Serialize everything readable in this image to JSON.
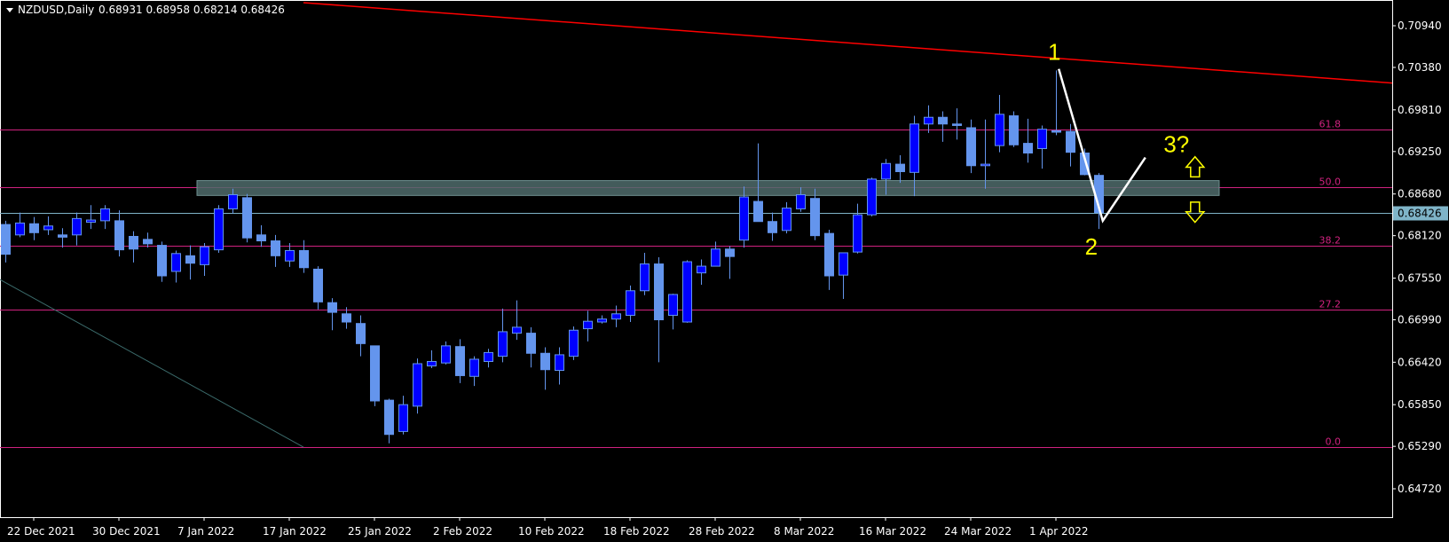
{
  "header": {
    "symbol": "NZDUSD,Daily",
    "ohlc": "0.68931 0.68958 0.68214 0.68426"
  },
  "current_price_label": "0.68426",
  "colors": {
    "background": "#000000",
    "axis": "#ffffff",
    "bull_body": "#0000ff",
    "bear_body": "#6495ed",
    "wick": "#6495ed",
    "fib": "#d0227f",
    "trendline": "#ff0000",
    "zone": "#4f6b6b",
    "annotation": "#ffff00",
    "wave": "#ffffff",
    "price_line": "#7fb4c8",
    "price_tag_bg": "#7fb4c8"
  },
  "chart_data": {
    "type": "candlestick",
    "title": "NZDUSD,Daily",
    "ylim": [
      0.6445,
      0.7125
    ],
    "y_ticks": [
      "0.70940",
      "0.70380",
      "0.69810",
      "0.69250",
      "0.68680",
      "0.68120",
      "0.67550",
      "0.66990",
      "0.66420",
      "0.65850",
      "0.65290",
      "0.64720"
    ],
    "x_tick_labels": [
      {
        "label": "22 Dec 2021",
        "index": 2
      },
      {
        "label": "30 Dec 2021",
        "index": 8
      },
      {
        "label": "7 Jan 2022",
        "index": 14
      },
      {
        "label": "17 Jan 2022",
        "index": 20
      },
      {
        "label": "25 Jan 2022",
        "index": 26
      },
      {
        "label": "2 Feb 2022",
        "index": 32
      },
      {
        "label": "10 Feb 2022",
        "index": 38
      },
      {
        "label": "18 Feb 2022",
        "index": 44
      },
      {
        "label": "28 Feb 2022",
        "index": 50
      },
      {
        "label": "8 Mar 2022",
        "index": 56
      },
      {
        "label": "16 Mar 2022",
        "index": 62
      },
      {
        "label": "24 Mar 2022",
        "index": 68
      },
      {
        "label": "1 Apr 2022",
        "index": 74
      }
    ],
    "candles": [
      {
        "o": 0.6827,
        "h": 0.6832,
        "l": 0.6776,
        "c": 0.6787
      },
      {
        "o": 0.6813,
        "h": 0.6843,
        "l": 0.681,
        "c": 0.6829
      },
      {
        "o": 0.6828,
        "h": 0.6837,
        "l": 0.6806,
        "c": 0.6816
      },
      {
        "o": 0.682,
        "h": 0.6838,
        "l": 0.6813,
        "c": 0.6825
      },
      {
        "o": 0.6813,
        "h": 0.6822,
        "l": 0.6796,
        "c": 0.681
      },
      {
        "o": 0.6813,
        "h": 0.6843,
        "l": 0.6799,
        "c": 0.6835
      },
      {
        "o": 0.683,
        "h": 0.6853,
        "l": 0.6821,
        "c": 0.6833
      },
      {
        "o": 0.6832,
        "h": 0.6853,
        "l": 0.6821,
        "c": 0.6848
      },
      {
        "o": 0.6832,
        "h": 0.6846,
        "l": 0.6784,
        "c": 0.6793
      },
      {
        "o": 0.6811,
        "h": 0.6818,
        "l": 0.6776,
        "c": 0.6794
      },
      {
        "o": 0.6807,
        "h": 0.6816,
        "l": 0.6796,
        "c": 0.6801
      },
      {
        "o": 0.6799,
        "h": 0.6804,
        "l": 0.675,
        "c": 0.6758
      },
      {
        "o": 0.6764,
        "h": 0.6792,
        "l": 0.6749,
        "c": 0.6788
      },
      {
        "o": 0.6785,
        "h": 0.6799,
        "l": 0.6753,
        "c": 0.6775
      },
      {
        "o": 0.6773,
        "h": 0.6802,
        "l": 0.6758,
        "c": 0.6797
      },
      {
        "o": 0.6793,
        "h": 0.6853,
        "l": 0.6789,
        "c": 0.6848
      },
      {
        "o": 0.6848,
        "h": 0.6875,
        "l": 0.6842,
        "c": 0.6867
      },
      {
        "o": 0.6863,
        "h": 0.6868,
        "l": 0.6803,
        "c": 0.6809
      },
      {
        "o": 0.6813,
        "h": 0.6826,
        "l": 0.6797,
        "c": 0.6805
      },
      {
        "o": 0.6805,
        "h": 0.6813,
        "l": 0.677,
        "c": 0.6785
      },
      {
        "o": 0.6778,
        "h": 0.6802,
        "l": 0.677,
        "c": 0.6792
      },
      {
        "o": 0.6792,
        "h": 0.6806,
        "l": 0.6762,
        "c": 0.6769
      },
      {
        "o": 0.6767,
        "h": 0.6771,
        "l": 0.6713,
        "c": 0.6723
      },
      {
        "o": 0.6722,
        "h": 0.6728,
        "l": 0.6685,
        "c": 0.6709
      },
      {
        "o": 0.6707,
        "h": 0.6716,
        "l": 0.6687,
        "c": 0.6696
      },
      {
        "o": 0.6694,
        "h": 0.6705,
        "l": 0.665,
        "c": 0.6667
      },
      {
        "o": 0.6664,
        "h": 0.6664,
        "l": 0.6583,
        "c": 0.659
      },
      {
        "o": 0.6591,
        "h": 0.6593,
        "l": 0.6533,
        "c": 0.6545
      },
      {
        "o": 0.6549,
        "h": 0.6597,
        "l": 0.6545,
        "c": 0.6585
      },
      {
        "o": 0.6583,
        "h": 0.6647,
        "l": 0.6573,
        "c": 0.664
      },
      {
        "o": 0.6637,
        "h": 0.6658,
        "l": 0.6634,
        "c": 0.6643
      },
      {
        "o": 0.6641,
        "h": 0.667,
        "l": 0.6639,
        "c": 0.6664
      },
      {
        "o": 0.6663,
        "h": 0.6673,
        "l": 0.6614,
        "c": 0.6624
      },
      {
        "o": 0.6623,
        "h": 0.665,
        "l": 0.661,
        "c": 0.6646
      },
      {
        "o": 0.6643,
        "h": 0.666,
        "l": 0.6635,
        "c": 0.6655
      },
      {
        "o": 0.665,
        "h": 0.6714,
        "l": 0.6642,
        "c": 0.6683
      },
      {
        "o": 0.6681,
        "h": 0.6725,
        "l": 0.6672,
        "c": 0.6689
      },
      {
        "o": 0.6681,
        "h": 0.6689,
        "l": 0.6635,
        "c": 0.6654
      },
      {
        "o": 0.6654,
        "h": 0.6662,
        "l": 0.6605,
        "c": 0.6632
      },
      {
        "o": 0.6631,
        "h": 0.6662,
        "l": 0.6612,
        "c": 0.6652
      },
      {
        "o": 0.665,
        "h": 0.669,
        "l": 0.6645,
        "c": 0.6685
      },
      {
        "o": 0.6687,
        "h": 0.6711,
        "l": 0.667,
        "c": 0.6697
      },
      {
        "o": 0.6696,
        "h": 0.6705,
        "l": 0.6694,
        "c": 0.67
      },
      {
        "o": 0.67,
        "h": 0.6718,
        "l": 0.6689,
        "c": 0.6707
      },
      {
        "o": 0.6705,
        "h": 0.6745,
        "l": 0.6696,
        "c": 0.6738
      },
      {
        "o": 0.6738,
        "h": 0.6789,
        "l": 0.6732,
        "c": 0.6774
      },
      {
        "o": 0.6774,
        "h": 0.6783,
        "l": 0.6642,
        "c": 0.6699
      },
      {
        "o": 0.6705,
        "h": 0.6734,
        "l": 0.6686,
        "c": 0.6733
      },
      {
        "o": 0.6696,
        "h": 0.6779,
        "l": 0.6695,
        "c": 0.6777
      },
      {
        "o": 0.6762,
        "h": 0.678,
        "l": 0.6746,
        "c": 0.6771
      },
      {
        "o": 0.6771,
        "h": 0.6804,
        "l": 0.6772,
        "c": 0.6794
      },
      {
        "o": 0.6794,
        "h": 0.6798,
        "l": 0.6754,
        "c": 0.6784
      },
      {
        "o": 0.6806,
        "h": 0.6878,
        "l": 0.6796,
        "c": 0.6864
      },
      {
        "o": 0.6858,
        "h": 0.6936,
        "l": 0.6832,
        "c": 0.6831
      },
      {
        "o": 0.6831,
        "h": 0.6843,
        "l": 0.6805,
        "c": 0.6816
      },
      {
        "o": 0.6819,
        "h": 0.6857,
        "l": 0.6815,
        "c": 0.6849
      },
      {
        "o": 0.6848,
        "h": 0.6877,
        "l": 0.6844,
        "c": 0.6867
      },
      {
        "o": 0.6862,
        "h": 0.6875,
        "l": 0.6806,
        "c": 0.6812
      },
      {
        "o": 0.6815,
        "h": 0.682,
        "l": 0.6739,
        "c": 0.6758
      },
      {
        "o": 0.6759,
        "h": 0.6785,
        "l": 0.6727,
        "c": 0.6789
      },
      {
        "o": 0.679,
        "h": 0.6855,
        "l": 0.6788,
        "c": 0.684
      },
      {
        "o": 0.684,
        "h": 0.689,
        "l": 0.6838,
        "c": 0.6888
      },
      {
        "o": 0.6888,
        "h": 0.6915,
        "l": 0.6867,
        "c": 0.6909
      },
      {
        "o": 0.6908,
        "h": 0.692,
        "l": 0.6883,
        "c": 0.6898
      },
      {
        "o": 0.6897,
        "h": 0.6973,
        "l": 0.6865,
        "c": 0.6962
      },
      {
        "o": 0.6962,
        "h": 0.6987,
        "l": 0.695,
        "c": 0.6971
      },
      {
        "o": 0.6971,
        "h": 0.6979,
        "l": 0.6938,
        "c": 0.6962
      },
      {
        "o": 0.6962,
        "h": 0.6983,
        "l": 0.6941,
        "c": 0.696
      },
      {
        "o": 0.6957,
        "h": 0.6968,
        "l": 0.6896,
        "c": 0.6906
      },
      {
        "o": 0.6906,
        "h": 0.6968,
        "l": 0.6875,
        "c": 0.6908
      },
      {
        "o": 0.6933,
        "h": 0.7001,
        "l": 0.6924,
        "c": 0.6975
      },
      {
        "o": 0.6973,
        "h": 0.6979,
        "l": 0.6931,
        "c": 0.6934
      },
      {
        "o": 0.6936,
        "h": 0.6969,
        "l": 0.691,
        "c": 0.6923
      },
      {
        "o": 0.6929,
        "h": 0.696,
        "l": 0.6902,
        "c": 0.6955
      },
      {
        "o": 0.6953,
        "h": 0.7034,
        "l": 0.6947,
        "c": 0.6951
      },
      {
        "o": 0.6952,
        "h": 0.6962,
        "l": 0.6905,
        "c": 0.6924
      },
      {
        "o": 0.6923,
        "h": 0.6929,
        "l": 0.6893,
        "c": 0.6894
      },
      {
        "o": 0.6893,
        "h": 0.6896,
        "l": 0.6821,
        "c": 0.6843
      }
    ],
    "fib_levels": [
      {
        "label": "61.8",
        "price": 0.6955
      },
      {
        "label": "50.0",
        "price": 0.6877
      },
      {
        "label": "38.2",
        "price": 0.6799
      },
      {
        "label": "27.2",
        "price": 0.6713
      },
      {
        "label": "0.0",
        "price": 0.6528
      }
    ],
    "current_price": 0.68426,
    "annotations": [
      "1",
      "2",
      "3?"
    ]
  }
}
